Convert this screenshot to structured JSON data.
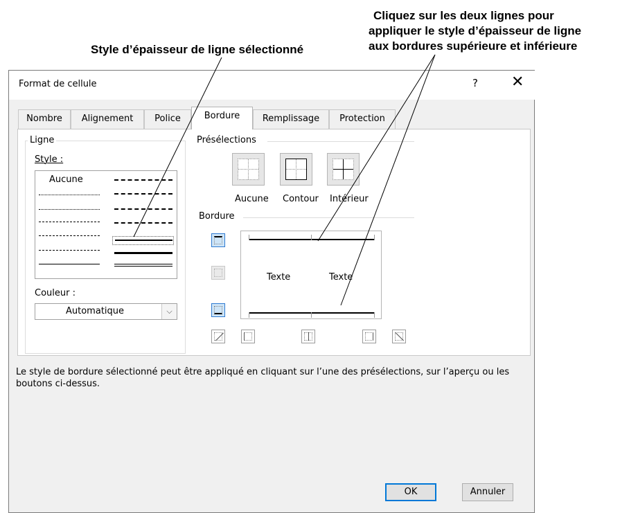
{
  "annotations": {
    "selected_style": "Style d’épaisseur de ligne sélectionné",
    "click_lines": [
      "Cliquez sur les deux lignes pour",
      "appliquer le style d’épaisseur de ligne",
      "aux bordures supérieure et inférieure"
    ]
  },
  "dialog": {
    "title": "Format de cellule",
    "help": "?",
    "close": "✕",
    "tabs": [
      "Nombre",
      "Alignement",
      "Police",
      "Bordure",
      "Remplissage",
      "Protection"
    ],
    "active_tab": "Bordure"
  },
  "line_group": {
    "legend": "Ligne",
    "style_label": "Style :",
    "none_option": "Aucune",
    "color_label": "Couleur :",
    "color_value": "Automatique"
  },
  "presets": {
    "legend": "Présélections",
    "items": [
      "Aucune",
      "Contour",
      "Intérieur"
    ]
  },
  "border": {
    "legend": "Bordure",
    "preview_text_left": "Texte",
    "preview_text_right": "Texte"
  },
  "description": "Le style de bordure sélectionné peut être appliqué en cliquant sur l’une des présélections, sur l’aperçu ou les boutons ci-dessus.",
  "buttons": {
    "ok": "OK",
    "cancel": "Annuler"
  },
  "colors": {
    "accent": "#0078d7",
    "selected_button_bg": "#cde4f7"
  }
}
